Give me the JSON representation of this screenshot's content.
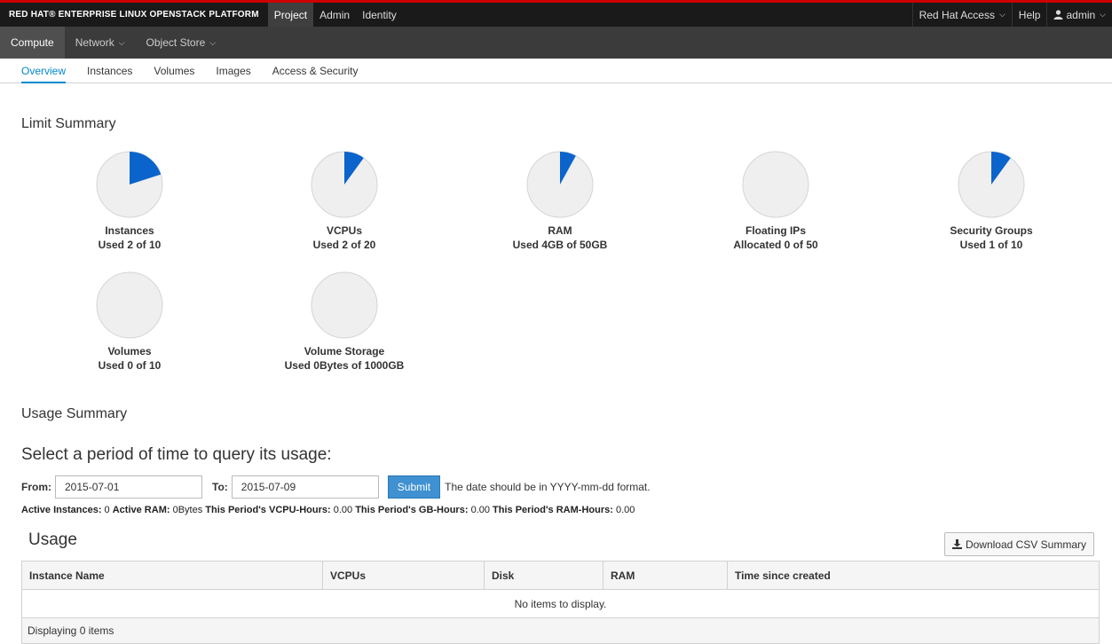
{
  "brand": "RED HAT® ENTERPRISE LINUX OPENSTACK PLATFORM",
  "top_nav": [
    {
      "label": "Project",
      "active": true
    },
    {
      "label": "Admin",
      "active": false
    },
    {
      "label": "Identity",
      "active": false
    }
  ],
  "top_right": {
    "access": "Red Hat Access",
    "help": "Help",
    "user": "admin"
  },
  "sub_nav": [
    {
      "label": "Compute",
      "active": true
    },
    {
      "label": "Network",
      "active": false
    },
    {
      "label": "Object Store",
      "active": false
    }
  ],
  "tabs": [
    {
      "label": "Overview",
      "active": true
    },
    {
      "label": "Instances",
      "active": false
    },
    {
      "label": "Volumes",
      "active": false
    },
    {
      "label": "Images",
      "active": false
    },
    {
      "label": "Access & Security",
      "active": false
    }
  ],
  "limit_summary": {
    "heading": "Limit Summary",
    "colors": {
      "used": "#0b64cc",
      "free": "#efefef"
    },
    "pies": [
      {
        "name": "Instances",
        "detail": "Used 2 of 10",
        "fraction": 0.2
      },
      {
        "name": "VCPUs",
        "detail": "Used 2 of 20",
        "fraction": 0.1
      },
      {
        "name": "RAM",
        "detail": "Used 4GB of 50GB",
        "fraction": 0.08
      },
      {
        "name": "Floating IPs",
        "detail": "Allocated 0 of 50",
        "fraction": 0
      },
      {
        "name": "Security Groups",
        "detail": "Used 1 of 10",
        "fraction": 0.1
      },
      {
        "name": "Volumes",
        "detail": "Used 0 of 10",
        "fraction": 0
      },
      {
        "name": "Volume Storage",
        "detail": "Used 0Bytes of 1000GB",
        "fraction": 0
      }
    ]
  },
  "usage_summary": {
    "heading": "Usage Summary",
    "period_heading": "Select a period of time to query its usage:",
    "from_label": "From:",
    "from_value": "2015-07-01",
    "to_label": "To:",
    "to_value": "2015-07-09",
    "submit_label": "Submit",
    "hint": "The date should be in YYYY-mm-dd format.",
    "totals": {
      "active_instances_label": "Active Instances:",
      "active_instances": "0",
      "active_ram_label": "Active RAM:",
      "active_ram": "0Bytes",
      "vcpu_hours_label": "This Period's VCPU-Hours:",
      "vcpu_hours": "0.00",
      "gb_hours_label": "This Period's GB-Hours:",
      "gb_hours": "0.00",
      "ram_hours_label": "This Period's RAM-Hours:",
      "ram_hours": "0.00"
    }
  },
  "usage": {
    "heading": "Usage",
    "download_label": "Download CSV Summary",
    "columns": [
      "Instance Name",
      "VCPUs",
      "Disk",
      "RAM",
      "Time since created"
    ],
    "empty_text": "No items to display.",
    "footer": "Displaying 0 items"
  }
}
